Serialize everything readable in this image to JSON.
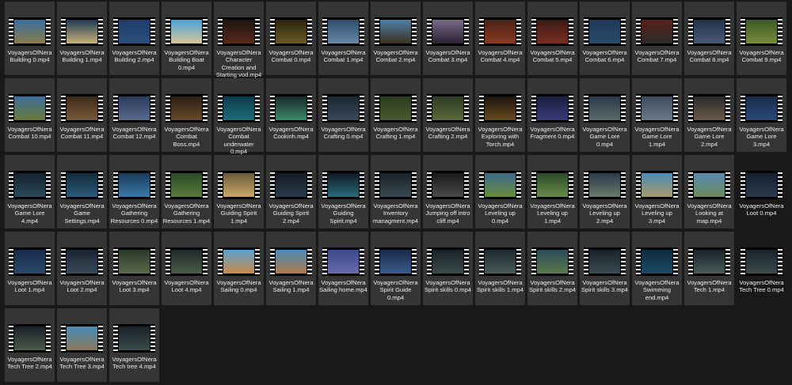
{
  "files": [
    {
      "name": "VoyagersOfNera Building 0.mp4",
      "c1": "#3b6fa0",
      "c2": "#8a7a4a",
      "selected": true
    },
    {
      "name": "VoyagersOfNera Building 1.mp4",
      "c1": "#1e3a55",
      "c2": "#c9b27a",
      "selected": true
    },
    {
      "name": "VoyagersOfNera Building 2.mp4",
      "c1": "#1f3d6b",
      "c2": "#2c4f7a",
      "selected": true
    },
    {
      "name": "VoyagersOfNera Building Boat 0.mp4",
      "c1": "#4aa3d9",
      "c2": "#d8c79a",
      "selected": true
    },
    {
      "name": "VoyagersOfNera Character Creation and Starting vod.mp4",
      "c1": "#1b1412",
      "c2": "#5a2a1a",
      "selected": true
    },
    {
      "name": "VoyagersOfNera Combat 0.mp4",
      "c1": "#2a2410",
      "c2": "#6a5a22",
      "selected": true
    },
    {
      "name": "VoyagersOfNera Combat 1.mp4",
      "c1": "#2c4a6a",
      "c2": "#6a88a8",
      "selected": true
    },
    {
      "name": "VoyagersOfNera Combat 2.mp4",
      "c1": "#4f7fa6",
      "c2": "#3a3020",
      "selected": true
    },
    {
      "name": "VoyagersOfNera Combat 3.mp4",
      "c1": "#7a6a8a",
      "c2": "#2a2030",
      "selected": true
    },
    {
      "name": "VoyagersOfNera Combat 4.mp4",
      "c1": "#4a2218",
      "c2": "#8a3a22",
      "selected": true
    },
    {
      "name": "VoyagersOfNera Combat 5.mp4",
      "c1": "#3a1a14",
      "c2": "#7a2e22",
      "selected": true
    },
    {
      "name": "VoyagersOfNera Combat 6.mp4",
      "c1": "#1e3a5a",
      "c2": "#2a4a6a",
      "selected": true
    },
    {
      "name": "VoyagersOfNera Combat 7.mp4",
      "c1": "#5a2018",
      "c2": "#2a2a2a",
      "selected": true
    },
    {
      "name": "VoyagersOfNera Combat 8.mp4",
      "c1": "#22324a",
      "c2": "#4a5a72",
      "selected": true
    },
    {
      "name": "VoyagersOfNera Combat 9.mp4",
      "c1": "#3a5a2a",
      "c2": "#7a8a3a",
      "selected": true
    },
    {
      "name": "VoyagersOfNera Combat 10.mp4",
      "c1": "#3f6e9a",
      "c2": "#6a7a3a",
      "selected": true
    },
    {
      "name": "VoyagersOfNera Combat 11.mp4",
      "c1": "#3a2a1a",
      "c2": "#7a5a3a",
      "selected": true
    },
    {
      "name": "VoyagersOfNera Combat 12.mp4",
      "c1": "#2a3a5a",
      "c2": "#5a6a8a",
      "selected": true
    },
    {
      "name": "VoyagersOfNera Combat Boss.mp4",
      "c1": "#2a1e14",
      "c2": "#6a4a2a",
      "selected": true
    },
    {
      "name": "VoyagersOfNera Combat underwater 0.mp4",
      "c1": "#0e3a4a",
      "c2": "#1e6a7a",
      "selected": true
    },
    {
      "name": "VoyagersOfNera Cookinh.mp4",
      "c1": "#1a2a2a",
      "c2": "#3a8a6a",
      "selected": true
    },
    {
      "name": "VoyagersOfNera Crafting 0.mp4",
      "c1": "#1a2630",
      "c2": "#3a4a5a",
      "selected": true
    },
    {
      "name": "VoyagersOfNera Crafting 1.mp4",
      "c1": "#2a3a1e",
      "c2": "#4a5a2e",
      "selected": true
    },
    {
      "name": "VoyagersOfNera Crafting 2.mp4",
      "c1": "#2e3a24",
      "c2": "#5a6a3a",
      "selected": true
    },
    {
      "name": "VoyagersOfNera Exploring with Torch.mp4",
      "c1": "#1a1410",
      "c2": "#6a4a1e",
      "selected": true
    },
    {
      "name": "VoyagersOfNera Fragment 0.mp4",
      "c1": "#1a1e3a",
      "c2": "#3a3a7a",
      "selected": true
    },
    {
      "name": "VoyagersOfNera Game Lore 0.mp4",
      "c1": "#2a3a4a",
      "c2": "#5a6a6a",
      "selected": true
    },
    {
      "name": "VoyagersOfNera Game Lore 1.mp4",
      "c1": "#3a4a5a",
      "c2": "#6a7a8a",
      "selected": true
    },
    {
      "name": "VoyagersOfNera Game Lore 2.mp4",
      "c1": "#2a2a2a",
      "c2": "#6a5a4a",
      "selected": true
    },
    {
      "name": "VoyagersOfNera Game Lore 3.mp4",
      "c1": "#1a2a4a",
      "c2": "#2a4a7a",
      "selected": true
    },
    {
      "name": "VoyagersOfNera Game Lore 4.mp4",
      "c1": "#14222e",
      "c2": "#2a4a5a",
      "selected": true
    },
    {
      "name": "VoyagersOfNera Game Settings.mp4",
      "c1": "#142a3a",
      "c2": "#2a5a7a",
      "selected": true
    },
    {
      "name": "VoyagersOfNera Gathering Resources 0.mp4",
      "c1": "#1a3a5a",
      "c2": "#3a7aa8",
      "selected": true
    },
    {
      "name": "VoyagersOfNera Gathering Resources 1.mp4",
      "c1": "#2a4a2a",
      "c2": "#5a7a3a",
      "selected": true
    },
    {
      "name": "VoyagersOfNera Guiding Spirit 1.mp4",
      "c1": "#6a5a3a",
      "c2": "#c9a86a",
      "selected": true
    },
    {
      "name": "VoyagersOfNera Guiding Spirit 2.mp4",
      "c1": "#141a22",
      "c2": "#2a3a4a",
      "selected": true
    },
    {
      "name": "VoyagersOfNera Guiding Spirit.mp4",
      "c1": "#0e1a22",
      "c2": "#2a6a7a",
      "selected": true
    },
    {
      "name": "VoyagersOfNera Inventory managment.mp4",
      "c1": "#1a2228",
      "c2": "#3a4a52",
      "selected": true
    },
    {
      "name": "VoyagersOfNera Jumping off intro cliff.mp4",
      "c1": "#1a1a1a",
      "c2": "#4a4a4a",
      "selected": true
    },
    {
      "name": "VoyagersOfNera Leveling up 0.mp4",
      "c1": "#3a6a8a",
      "c2": "#6a8a3a",
      "selected": true
    },
    {
      "name": "VoyagersOfNera Leveling up 1.mp4",
      "c1": "#2a4a2a",
      "c2": "#6a8a4a",
      "selected": true
    },
    {
      "name": "VoyagersOfNera Leveling up 2.mp4",
      "c1": "#2a3a4a",
      "c2": "#6a7a6a",
      "selected": true
    },
    {
      "name": "VoyagersOfNera Leveling up 3.mp4",
      "c1": "#4a8ab8",
      "c2": "#a89a6a",
      "selected": true
    },
    {
      "name": "VoyagersOfNera Looking at map.mp4",
      "c1": "#5a8ab0",
      "c2": "#6a8a5a",
      "selected": true
    },
    {
      "name": "VoyagersOfNera Loot 0.mp4",
      "c1": "#14222e",
      "c2": "#2a3a4a",
      "selected": false
    },
    {
      "name": "VoyagersOfNera Loot 1.mp4",
      "c1": "#1a2a4a",
      "c2": "#2a4a6a",
      "selected": true
    },
    {
      "name": "VoyagersOfNera Loot 2.mp4",
      "c1": "#1a2430",
      "c2": "#3a4a5a",
      "selected": true
    },
    {
      "name": "VoyagersOfNera Loot 3.mp4",
      "c1": "#2a3a2a",
      "c2": "#5a6a4a",
      "selected": true
    },
    {
      "name": "VoyagersOfNera Loot 4.mp4",
      "c1": "#1e2a2a",
      "c2": "#4a5a4a",
      "selected": true
    },
    {
      "name": "VoyagersOfNera Sailing 0.mp4",
      "c1": "#5aa0d0",
      "c2": "#c98a4a",
      "selected": true
    },
    {
      "name": "VoyagersOfNera Sailing 1.mp4",
      "c1": "#4a8ab8",
      "c2": "#b07a4a",
      "selected": true
    },
    {
      "name": "VoyagersOfNera Sailing home.mp4",
      "c1": "#3a4a8a",
      "c2": "#6a6ab0",
      "selected": true
    },
    {
      "name": "VoyagersOfNera Spirit Guide 0.mp4",
      "c1": "#1a2a4a",
      "c2": "#3a5a8a",
      "selected": true
    },
    {
      "name": "VoyagersOfNera Spirit skills 0.mp4",
      "c1": "#1a2228",
      "c2": "#3a4a4a",
      "selected": true
    },
    {
      "name": "VoyagersOfNera Spirit skills 1.mp4",
      "c1": "#1e2a2e",
      "c2": "#4a5a5a",
      "selected": true
    },
    {
      "name": "VoyagersOfNera Spirit skills 2.mp4",
      "c1": "#2a4a5a",
      "c2": "#5a7a4a",
      "selected": true
    },
    {
      "name": "VoyagersOfNera Spirit skills 3.mp4",
      "c1": "#1a2228",
      "c2": "#3a4a52",
      "selected": true
    },
    {
      "name": "VoyagersOfNera Swimming end.mp4",
      "c1": "#0e2a3a",
      "c2": "#1e4a6a",
      "selected": true
    },
    {
      "name": "VoyagersOfNera Tech 1.mp4",
      "c1": "#1a2228",
      "c2": "#4a5a5a",
      "selected": true
    },
    {
      "name": "VoyagersOfNera Tech Tree 0.mp4",
      "c1": "#1a2228",
      "c2": "#3a4a4a",
      "selected": false
    },
    {
      "name": "VoyagersOfNera Tech Tree 2.mp4",
      "c1": "#1a2228",
      "c2": "#4a5a4a",
      "selected": true
    },
    {
      "name": "VoyagersOfNera Tech Tree 3.mp4",
      "c1": "#4a8ab8",
      "c2": "#8a7a5a",
      "selected": true
    },
    {
      "name": "VoyagersOfNera Tech tree 4.mp4",
      "c1": "#1a2228",
      "c2": "#3a4a4a",
      "selected": true
    }
  ]
}
